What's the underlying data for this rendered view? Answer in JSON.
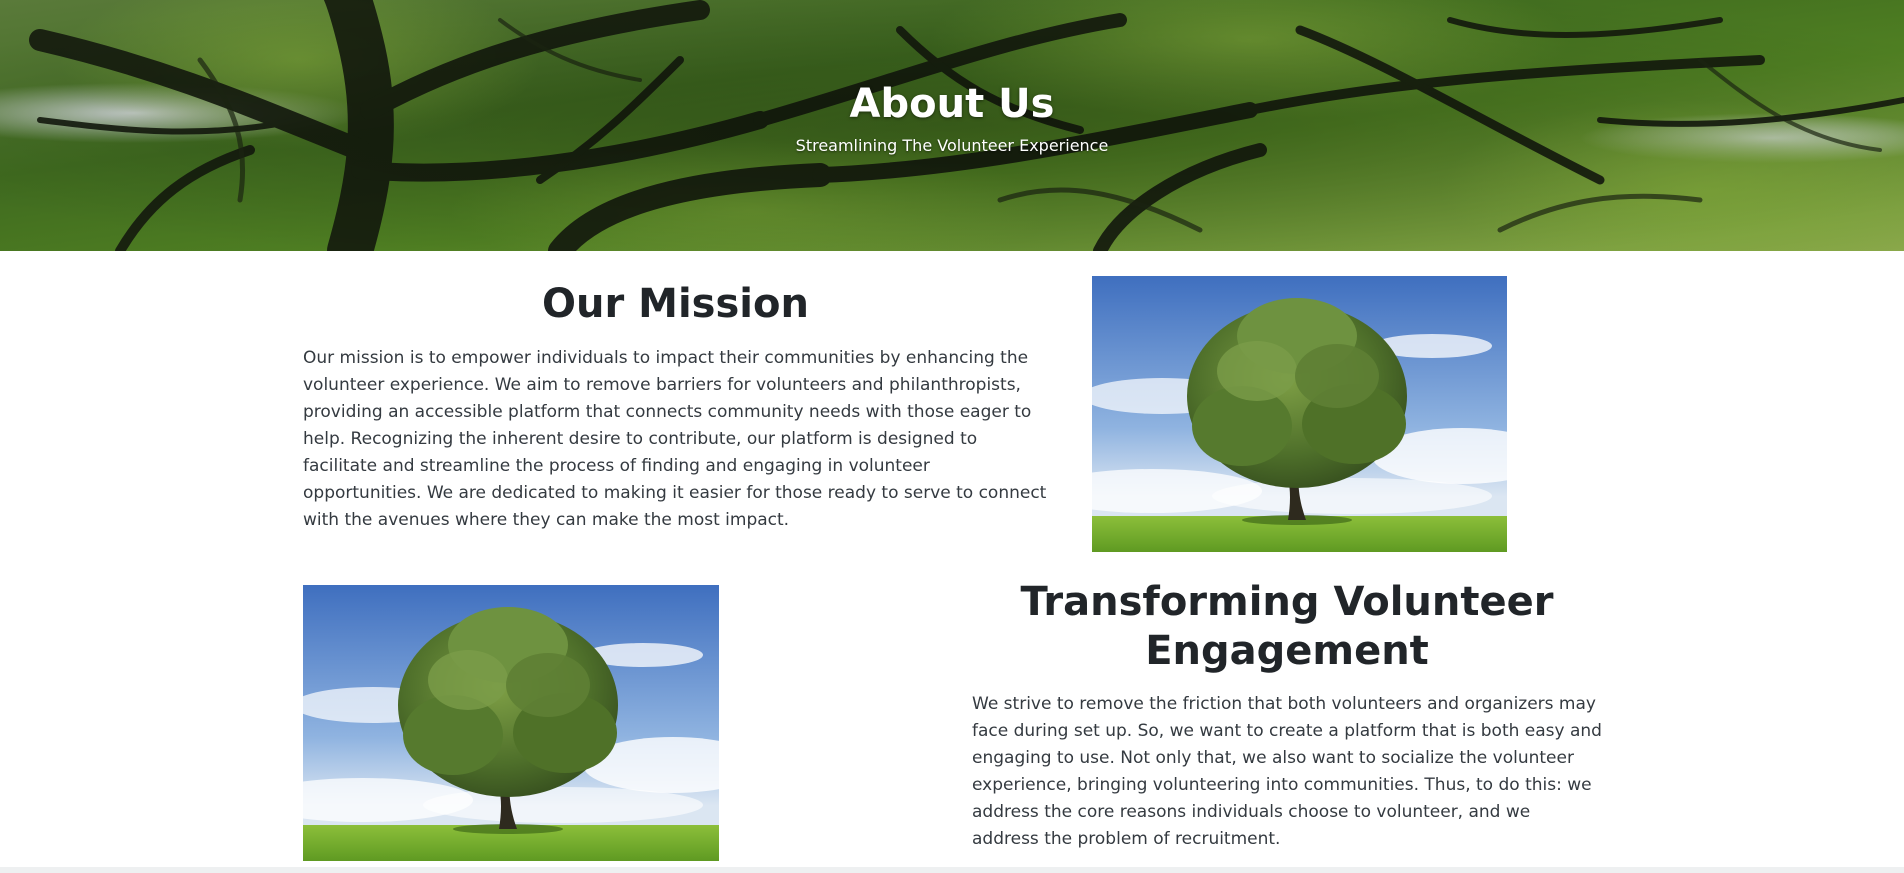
{
  "hero": {
    "title": "About Us",
    "subtitle": "Streamlining The Volunteer Experience",
    "background": "tree-canopy-photo"
  },
  "mission": {
    "title": "Our Mission",
    "body": "Our mission is to empower individuals to impact their communities by enhancing the volunteer experience. We aim to remove barriers for volunteers and philanthropists, providing an accessible platform that connects community needs with those eager to help. Recognizing the inherent desire to contribute, our platform is designed to facilitate and streamline the process of finding and engaging in volunteer opportunities. We are dedicated to making it easier for those ready to serve to connect with the avenues where they can make the most impact.",
    "image": "oak-tree-photo"
  },
  "engagement": {
    "title": "Transforming Volunteer Engagement",
    "body": "We strive to remove the friction that both volunteers and organizers may face during set up. So, we want to create a platform that is both easy and engaging to use. Not only that, we also want to socialize the volunteer experience, bringing volunteering into communities. Thus, to do this: we address the core reasons individuals choose to volunteer, and we address the problem of recruitment.",
    "image": "oak-tree-photo"
  },
  "colors": {
    "heading": "#212529",
    "body_text": "#343a40",
    "hero_text": "#ffffff"
  }
}
